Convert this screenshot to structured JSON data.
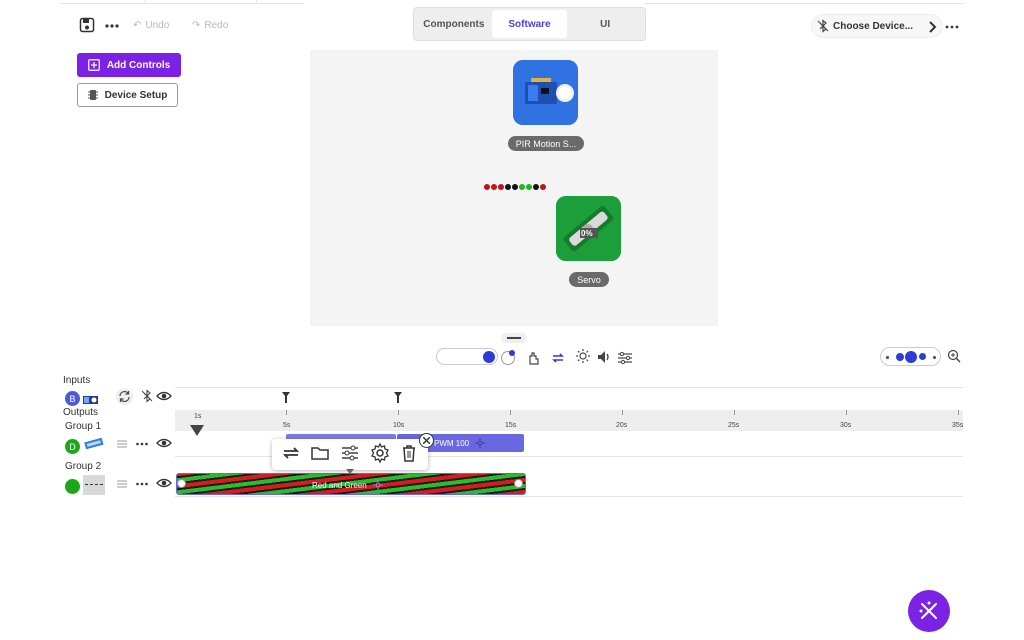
{
  "toolbar": {
    "undo_label": "Undo",
    "redo_label": "Redo"
  },
  "tabs": [
    {
      "label": "Components",
      "active": false
    },
    {
      "label": "Software",
      "active": true
    },
    {
      "label": "UI",
      "active": false
    }
  ],
  "device": {
    "choose_label": "Choose Device..."
  },
  "side_buttons": {
    "add_controls": "Add Controls",
    "device_setup": "Device Setup"
  },
  "canvas": {
    "nodes": [
      {
        "label": "PIR Motion S...",
        "icon": "pir-sensor-icon"
      },
      {
        "label": "Servo",
        "icon": "servo-icon",
        "badge": "0%"
      }
    ],
    "led_dots": [
      "#c0131b",
      "#c0131b",
      "#c0131b",
      "#111111",
      "#111111",
      "#24b524",
      "#24b524",
      "#111111",
      "#c0131b"
    ]
  },
  "timeline": {
    "inputs_label": "Inputs",
    "outputs_label": "Outputs",
    "input_badge": "B",
    "groups": [
      {
        "name": "Group 1",
        "badge": "D",
        "badge_color": "#1aa81a"
      },
      {
        "name": "Group 2",
        "badge": "",
        "badge_color": "#1aa81a"
      }
    ],
    "ticks": [
      "1s",
      "5s",
      "10s",
      "15s",
      "20s",
      "25s",
      "30s",
      "35s"
    ],
    "clips": {
      "pwm": "PWM 100",
      "led": "Red and Green"
    }
  },
  "colors": {
    "accent": "#7c22e6",
    "tab_active": "#4b3fe0",
    "clip": "#6a68e0"
  }
}
